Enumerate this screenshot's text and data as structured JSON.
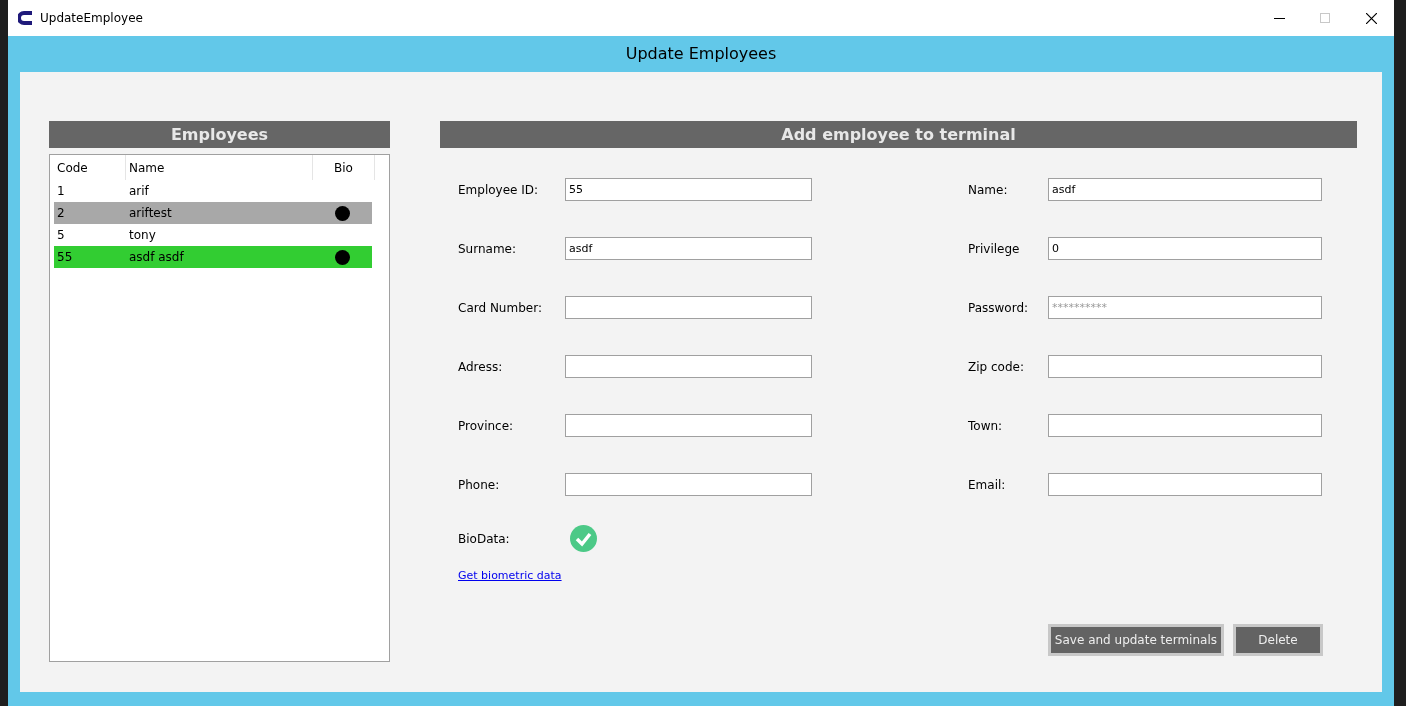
{
  "window": {
    "title": "UpdateEmployee",
    "maximize_disabled": true
  },
  "header": {
    "title": "Update Employees"
  },
  "employees": {
    "title": "Employees",
    "columns": [
      "Code",
      "Name",
      "Bio"
    ],
    "rows": [
      {
        "code": "1",
        "name": "arif",
        "bio": false,
        "selected": false,
        "highlighted": false
      },
      {
        "code": "2",
        "name": "ariftest",
        "bio": true,
        "selected": true,
        "highlighted": false
      },
      {
        "code": "5",
        "name": "tony",
        "bio": false,
        "selected": false,
        "highlighted": false
      },
      {
        "code": "55",
        "name": "asdf asdf",
        "bio": true,
        "selected": false,
        "highlighted": true
      }
    ]
  },
  "form": {
    "title": "Add employee to terminal",
    "rows": [
      {
        "left": {
          "label": "Employee ID:",
          "value": "55"
        },
        "right": {
          "label": "Name:",
          "value": "asdf"
        }
      },
      {
        "left": {
          "label": "Surname:",
          "value": "asdf"
        },
        "right": {
          "label": "Privilege",
          "value": "0"
        }
      },
      {
        "left": {
          "label": "Card Number:"
        },
        "right": {
          "label": "Password:",
          "placeholder": "**********"
        }
      },
      {
        "left": {
          "label": "Adress:"
        },
        "right": {
          "label": "Zip code:"
        }
      },
      {
        "left": {
          "label": "Province:"
        },
        "right": {
          "label": "Town:"
        }
      },
      {
        "left": {
          "label": "Phone:"
        },
        "right": {
          "label": "Email:"
        }
      }
    ],
    "biodata": {
      "label": "BioData:",
      "captured": true
    },
    "link": "Get biometric data",
    "buttons": [
      "Save and update terminals",
      "Delete"
    ]
  }
}
